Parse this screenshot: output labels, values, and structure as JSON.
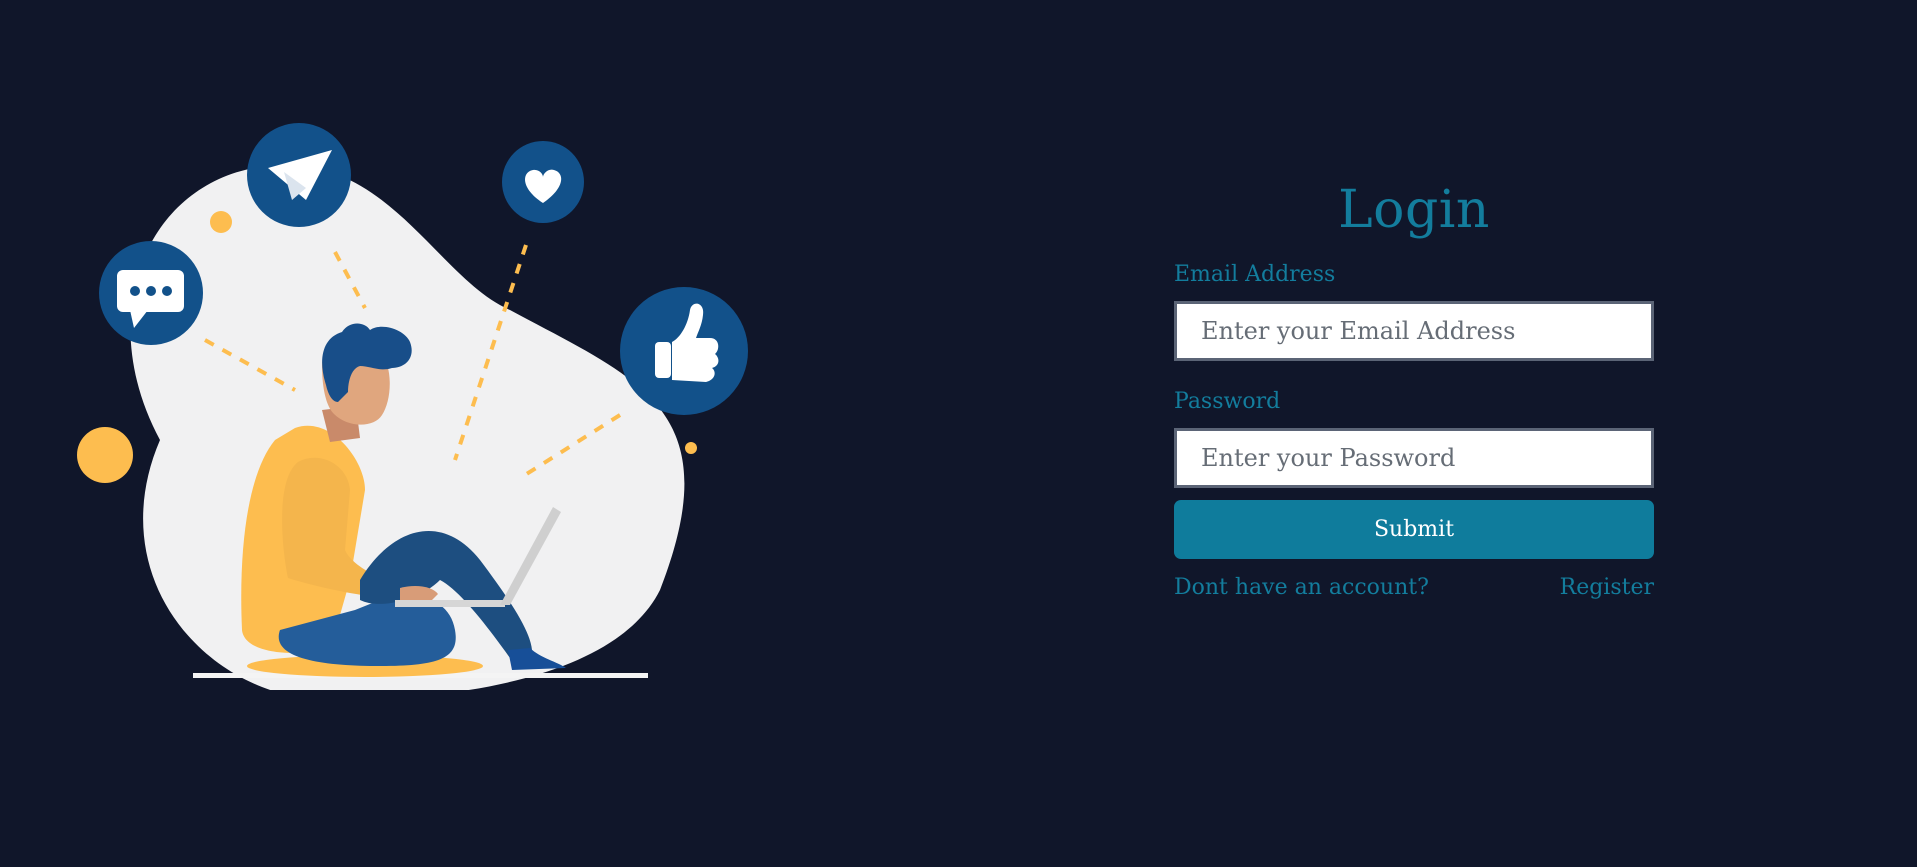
{
  "login": {
    "title": "Login",
    "email_label": "Email Address",
    "email_placeholder": "Enter your Email Address",
    "email_value": "",
    "password_label": "Password",
    "password_placeholder": "Enter your Password",
    "password_value": "",
    "submit_label": "Submit",
    "no_account_text": "Dont have an account?",
    "register_label": "Register"
  },
  "illustration": {
    "icons": [
      "paper-plane-icon",
      "heart-icon",
      "chat-bubble-icon",
      "thumbs-up-icon"
    ]
  },
  "colors": {
    "background": "#10162a",
    "accent": "#137d9d",
    "button": "#0f7c9c",
    "icon_circle": "#12518a",
    "yellow": "#fdbd4f",
    "blob": "#f1f1f2"
  }
}
